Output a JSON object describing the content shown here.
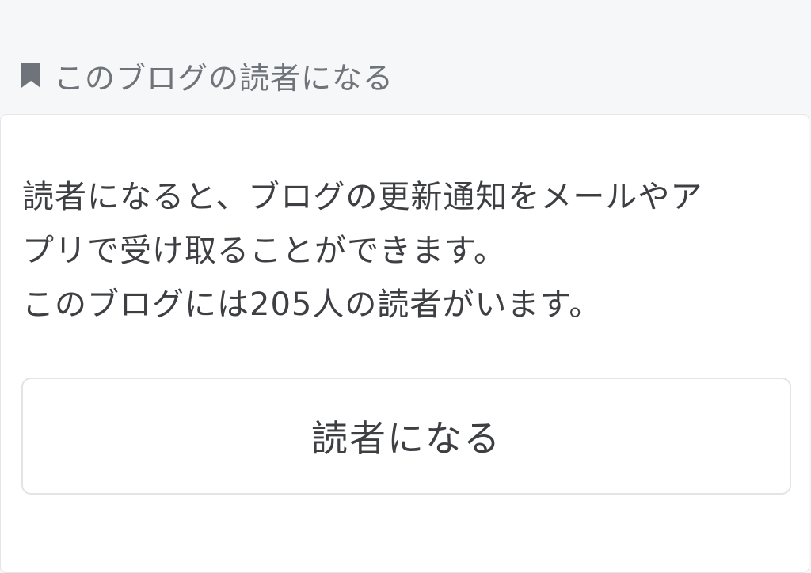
{
  "header": {
    "icon": "bookmark-icon",
    "title": "このブログの読者になる"
  },
  "card": {
    "description_lines": [
      "読者になると、ブログの更新通知をメールやア",
      "プリで受け取ることができます。",
      "このブログには205人の読者がいます。"
    ],
    "button_label": "読者になる"
  },
  "colors": {
    "page_background": "#f6f7f9",
    "card_background": "#ffffff",
    "header_text": "#6f747a",
    "body_text": "#3d3f43",
    "border": "#e2e4e8"
  }
}
